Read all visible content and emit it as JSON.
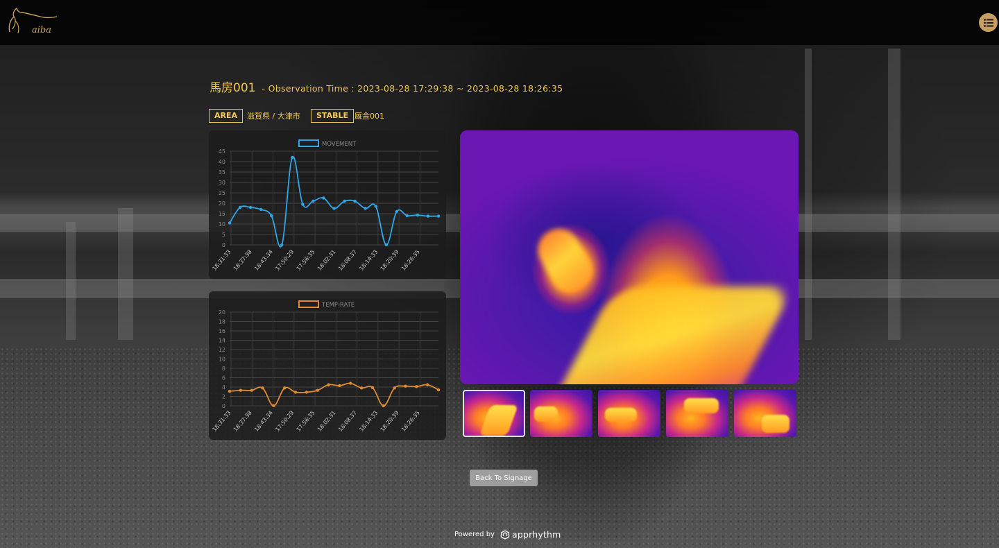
{
  "header": {
    "logo_text": "aiba",
    "menu_icon": "list-icon"
  },
  "page": {
    "title": "馬房001",
    "subtitle": "- Observation Time : 2023-08-28 17:29:38 ~ 2023-08-28 18:26:35"
  },
  "info": {
    "area_label": "AREA",
    "area_value": "滋賀県 / 大津市",
    "stable_label": "STABLE",
    "stable_value": "厩舎001"
  },
  "chart_data": [
    {
      "type": "line",
      "legend": "MOVEMENT",
      "color": "#2fa6e8",
      "ylim": [
        0,
        45
      ],
      "yticks": [
        0,
        5,
        10,
        15,
        20,
        25,
        30,
        35,
        40,
        45
      ],
      "tick_labels": [
        "18:31:33",
        "18:37:38",
        "18:43:34",
        "17:50:29",
        "17:56:35",
        "18:02:31",
        "18:08:37",
        "18:14:33",
        "18:20:39",
        "18:26:35"
      ],
      "values": [
        10.5,
        18,
        18,
        17,
        14,
        0,
        42,
        19.5,
        21,
        22.5,
        17.5,
        21,
        21,
        17.5,
        18.5,
        0,
        16,
        14,
        14.3,
        13.8,
        13.8
      ]
    },
    {
      "type": "line",
      "legend": "TEMP-RATE",
      "color": "#e08a34",
      "ylim": [
        0,
        20
      ],
      "yticks": [
        0,
        2,
        4,
        6,
        8,
        10,
        12,
        14,
        16,
        18,
        20
      ],
      "tick_labels": [
        "18:31:33",
        "18:37:38",
        "18:43:34",
        "17:50:29",
        "17:56:35",
        "18:02:31",
        "18:08:37",
        "18:14:33",
        "18:20:39",
        "18:26:35"
      ],
      "values": [
        3.1,
        3.3,
        3.3,
        3.8,
        0,
        3.8,
        2.9,
        2.9,
        3.3,
        4.5,
        4.3,
        4.8,
        3.8,
        3.9,
        0,
        3.8,
        4.2,
        4.1,
        4.5,
        3.4
      ]
    }
  ],
  "gallery": {
    "thumbnail_count": 5,
    "selected_index": 0
  },
  "actions": {
    "back_label": "Back To Signage"
  },
  "footer": {
    "powered_by": "Powered by",
    "brand": "apprhythm"
  }
}
